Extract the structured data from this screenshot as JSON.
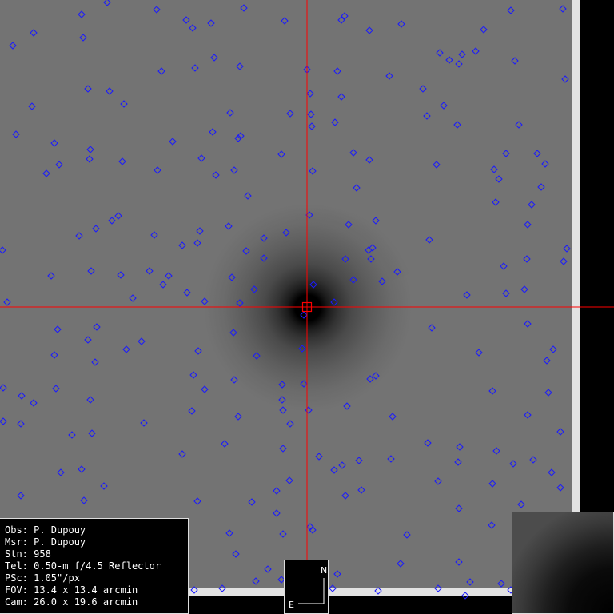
{
  "info": {
    "observer": "Obs: P. Dupouy",
    "measurer": "Msr: P. Dupouy",
    "station": "Stn: 958",
    "telescope": "Tel: 0.50-m f/4.5 Reflector",
    "pixel_scale": "PSc: 1.05\"/px",
    "fov": "FOV: 13.4 x 13.4 arcmin",
    "camera": "Cam: 26.0 x 19.6 arcmin"
  },
  "compass": {
    "north": "N",
    "east": "E"
  },
  "colors": {
    "crosshair": "#ff0000",
    "star_marker": "#1a1aff",
    "sky_background": "#737373"
  },
  "icons": {
    "target_marker": "square-reticle",
    "star_marker": "diamond"
  }
}
